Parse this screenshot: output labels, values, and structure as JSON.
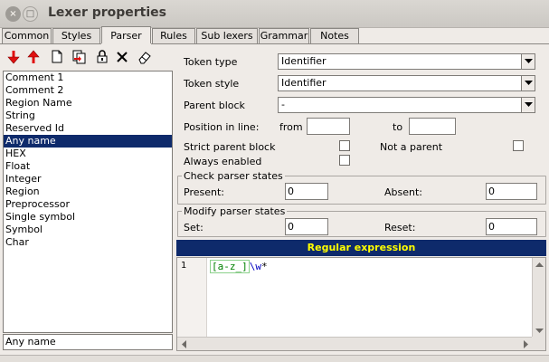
{
  "window": {
    "title": "Lexer properties",
    "close": "×",
    "maximize": "□"
  },
  "tabs": [
    {
      "label": "Common"
    },
    {
      "label": "Styles"
    },
    {
      "label": "Parser"
    },
    {
      "label": "Rules"
    },
    {
      "label": "Sub lexers"
    },
    {
      "label": "Grammar"
    },
    {
      "label": "Notes"
    }
  ],
  "active_tab": "Parser",
  "toolbar": {
    "icons": [
      "move-down-icon",
      "move-up-icon",
      "new-icon",
      "copy-icon",
      "lock-icon",
      "delete-icon",
      "erase-icon"
    ]
  },
  "token_list": {
    "items": [
      "Comment 1",
      "Comment 2",
      "Region Name",
      "String",
      "Reserved Id",
      "Any name",
      "HEX",
      "Float",
      "Integer",
      "Region",
      "Preprocessor",
      "Single symbol",
      "Symbol",
      "Char"
    ],
    "selected": "Any name"
  },
  "name_field": {
    "value": "Any name"
  },
  "form": {
    "token_type": {
      "label": "Token type",
      "value": "Identifier"
    },
    "token_style": {
      "label": "Token style",
      "value": "Identifier"
    },
    "parent_block": {
      "label": "Parent block",
      "value": "-"
    },
    "position": {
      "label": "Position in line:",
      "from_label": "from",
      "from_value": "",
      "to_label": "to",
      "to_value": ""
    },
    "strict_parent": {
      "label": "Strict parent block",
      "checked": false
    },
    "not_parent": {
      "label": "Not a parent",
      "checked": false
    },
    "always_enabled": {
      "label": "Always enabled",
      "checked": false
    }
  },
  "check_states": {
    "title": "Check parser states",
    "present_label": "Present:",
    "present_value": "0",
    "absent_label": "Absent:",
    "absent_value": "0"
  },
  "modify_states": {
    "title": "Modify parser states",
    "set_label": "Set:",
    "set_value": "0",
    "reset_label": "Reset:",
    "reset_value": "0"
  },
  "regex": {
    "header": "Regular expression",
    "line_number": "1",
    "class_part": "[a-z_]",
    "escape_part": "\\w",
    "quantifier_part": "*"
  },
  "colors": {
    "selection": "#0e2a6b",
    "header_text": "#ffff00",
    "regex_class": "#008000",
    "regex_escape": "#0000c0",
    "arrow_red": "#e01010"
  }
}
